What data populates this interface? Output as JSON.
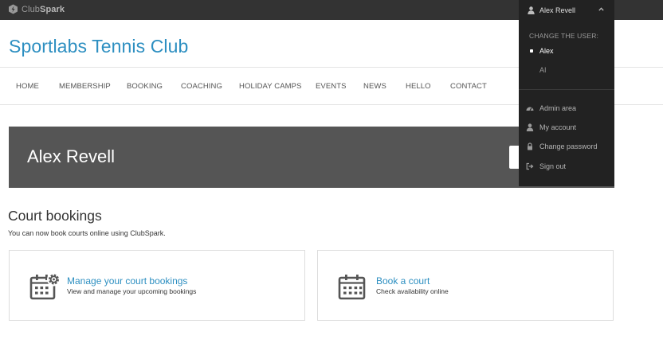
{
  "brand": {
    "logo_text_light": "Club",
    "logo_text_bold": "Spark"
  },
  "user_menu": {
    "user_name": "Alex Revell",
    "change_user_heading": "CHANGE THE USER:",
    "users": [
      {
        "name": "Alex",
        "active": true
      },
      {
        "name": "AI",
        "active": false
      }
    ],
    "items": [
      {
        "label": "Admin area",
        "icon": "dashboard-icon"
      },
      {
        "label": "My account",
        "icon": "user-icon"
      },
      {
        "label": "Change password",
        "icon": "lock-icon"
      },
      {
        "label": "Sign out",
        "icon": "sign-out-icon"
      }
    ]
  },
  "header": {
    "club_name": "Sportlabs Tennis Club"
  },
  "nav": {
    "items": [
      "HOME",
      "MEMBERSHIP",
      "BOOKING",
      "COACHING",
      "HOLIDAY CAMPS",
      "EVENTS",
      "NEWS",
      "HELLO",
      "CONTACT"
    ]
  },
  "banner": {
    "name": "Alex Revell"
  },
  "court_bookings": {
    "title": "Court bookings",
    "subtitle": "You can now book courts online using ClubSpark.",
    "cards": [
      {
        "title": "Manage your court bookings",
        "description": "View and manage your upcoming bookings",
        "icon": "calendar-gear-icon"
      },
      {
        "title": "Book a court",
        "description": "Check availability online",
        "icon": "calendar-icon"
      }
    ]
  },
  "colors": {
    "accent": "#2d8fc1",
    "topbar": "#333333",
    "dropdown": "#222222",
    "banner": "#555555"
  }
}
